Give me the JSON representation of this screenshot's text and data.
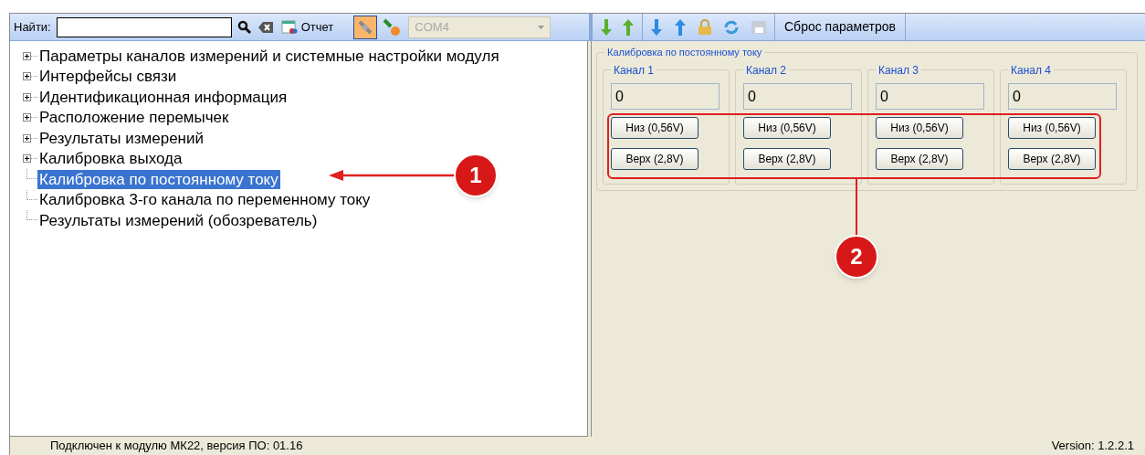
{
  "toolbar": {
    "search": {
      "label": "Найти:"
    },
    "report_button": "Отчет",
    "connect_pressed": true,
    "port": {
      "value": "COM4",
      "disabled": true
    }
  },
  "right_toolbar": {
    "reset_button": "Сброс параметров"
  },
  "tree": [
    {
      "label": "Параметры каналов измерений и системные настройки модуля",
      "has_children": true,
      "selected": false
    },
    {
      "label": "Интерфейсы связи",
      "has_children": true,
      "selected": false
    },
    {
      "label": "Идентификационная информация",
      "has_children": true,
      "selected": false
    },
    {
      "label": "Расположение перемычек",
      "has_children": true,
      "selected": false
    },
    {
      "label": "Результаты измерений",
      "has_children": true,
      "selected": false
    },
    {
      "label": "Калибровка выхода",
      "has_children": true,
      "selected": false
    },
    {
      "label": "Калибровка по постоянному току",
      "has_children": false,
      "selected": true
    },
    {
      "label": "Калибровка 3-го канала по переменному току",
      "has_children": false,
      "selected": false
    },
    {
      "label": "Результаты измерений (обозреватель)",
      "has_children": false,
      "selected": false
    }
  ],
  "panel": {
    "title": "Калибровка по постоянному току",
    "channels": [
      {
        "title": "Канал 1",
        "value": "0",
        "low_button": "Низ (0,56V)",
        "high_button": "Верх (2,8V)"
      },
      {
        "title": "Канал 2",
        "value": "0",
        "low_button": "Низ (0,56V)",
        "high_button": "Верх (2,8V)"
      },
      {
        "title": "Канал 3",
        "value": "0",
        "low_button": "Низ (0,56V)",
        "high_button": "Верх (2,8V)"
      },
      {
        "title": "Канал 4",
        "value": "0",
        "low_button": "Низ (0,56V)",
        "high_button": "Верх (2,8V)"
      }
    ]
  },
  "status_bar": {
    "message": "Подключен к модулю МК22, версия ПО: 01.16",
    "version": "Version: 1.2.2.1"
  },
  "annotations": [
    "1",
    "2"
  ]
}
